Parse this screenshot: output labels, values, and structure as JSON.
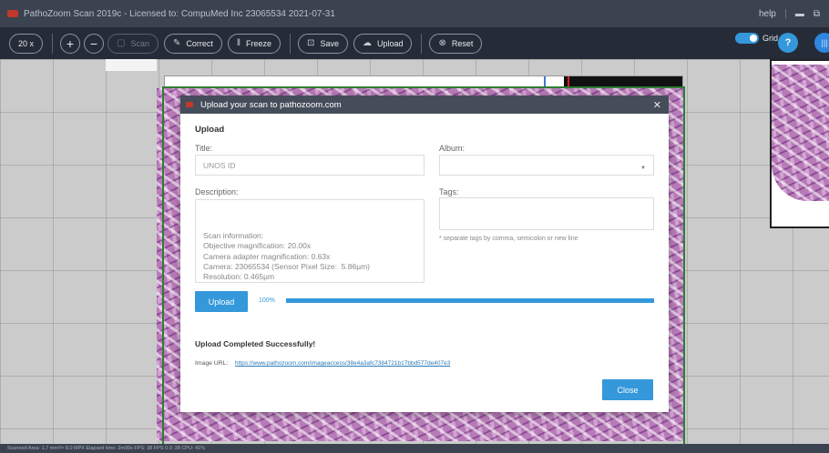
{
  "window": {
    "title": "PathoZoom Scan 2019c  - Licensed to:  CompuMed Inc 23065534 2021-07-31",
    "help_label": "help",
    "minimize_icon": "minimize-icon",
    "restore_icon": "restore-icon"
  },
  "toolbar": {
    "zoom_label": "20 x",
    "scan_label": "Scan",
    "correct_label": "Correct",
    "freeze_label": "Freeze",
    "save_label": "Save",
    "upload_label": "Upload",
    "reset_label": "Reset",
    "grid_label": "Grid",
    "grid_enabled": true,
    "help_label": "?",
    "info_label": "|||"
  },
  "modal": {
    "title": "Upload your scan to pathozoom.com",
    "section_title": "Upload",
    "title_label": "Title:",
    "title_placeholder": "UNOS ID",
    "album_label": "Album:",
    "album_value": "",
    "description_label": "Description:",
    "description_text": "Scan information:\nObjective magnification: 20.00x\nCamera adapter magnification: 0.63x\nCamera: 23065534 (Sensor Pixel Size:  5.86µm)\nResolution: 0.465µm",
    "tags_label": "Tags:",
    "tags_hint": "* separate tags by comma, semicolon or new line",
    "upload_button": "Upload",
    "progress_label": "100%",
    "progress_value": 1.0,
    "success_message": "Upload Completed Successfully!",
    "image_url_label": "Image URL:",
    "image_url": "https://www.pathozoom.com/imageaccess/38e4a3afc7384721b17bbd577de407e3",
    "close_button": "Close"
  },
  "statusbar": {
    "text": "Scanned Area: 1.7 mm²/≈ 8.0 MPX   Elapsed time: 2m09s   FPS: 38   FPS 0.0: 38   CPU: 41%"
  },
  "colors": {
    "accent": "#3498db",
    "titlebar": "#3b4350",
    "toolbar": "#252c38",
    "frame": "#2e7d32"
  }
}
